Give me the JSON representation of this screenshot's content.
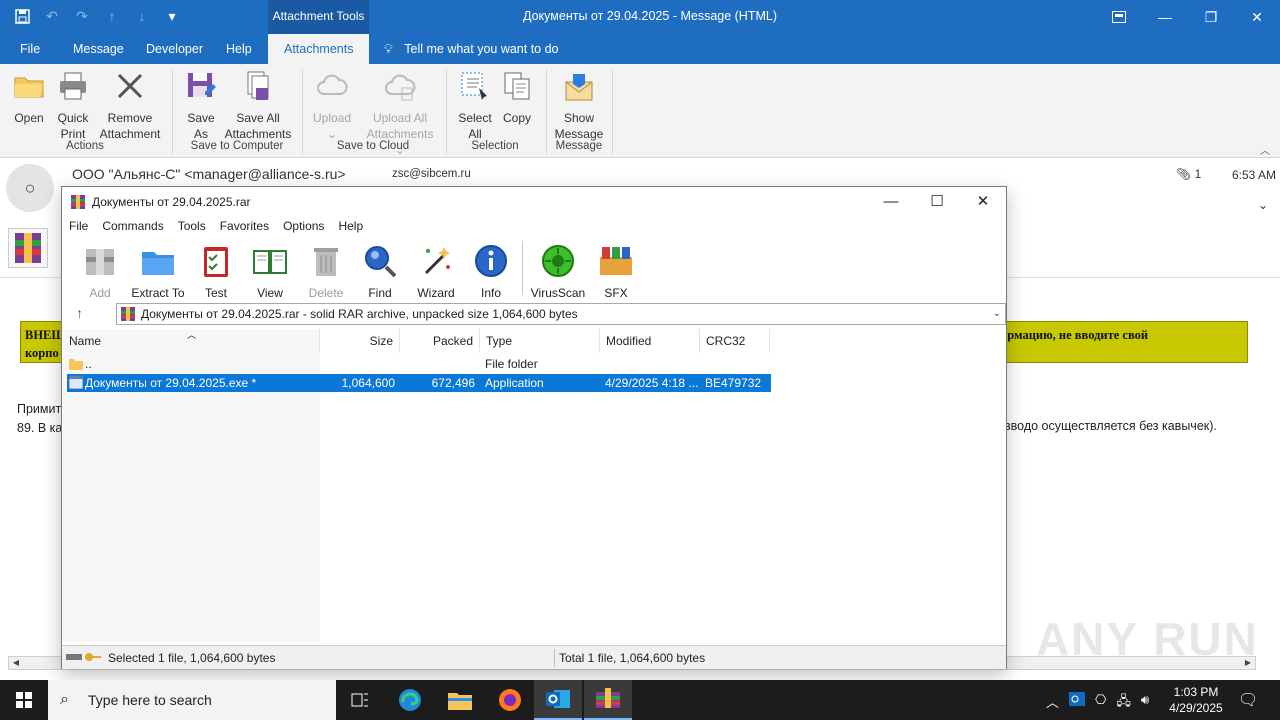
{
  "outlook": {
    "context_tab": "Attachment Tools",
    "window_title": "Документы от 29.04.2025  -  Message (HTML)",
    "tabs": [
      "File",
      "Message",
      "Developer",
      "Help",
      "Attachments"
    ],
    "active_tab": "Attachments",
    "tell_me": "Tell me what you want to do",
    "ribbon": {
      "open": "Open",
      "quick_print_1": "Quick",
      "quick_print_2": "Print",
      "remove_1": "Remove",
      "remove_2": "Attachment",
      "group_actions": "Actions",
      "save_as_1": "Save",
      "save_as_2": "As",
      "save_all_1": "Save All",
      "save_all_2": "Attachments",
      "group_save_computer": "Save to Computer",
      "upload": "Upload",
      "upload_all_1": "Upload All",
      "upload_all_2": "Attachments",
      "group_save_cloud": "Save to Cloud",
      "select_all_1": "Select",
      "select_all_2": "All",
      "copy": "Copy",
      "group_selection": "Selection",
      "show_message_1": "Show",
      "show_message_2": "Message",
      "group_message": "Message"
    },
    "header": {
      "from": "ООО \"Альянс-С\" <manager@alliance-s.ru>",
      "to": "zsc@sibcem.ru",
      "attachment_count": "1",
      "time": "6:53 AM"
    },
    "body": {
      "warning_left_1": "ВНЕШ",
      "warning_left_2": "корпо",
      "warning_right": "ормацию, не вводите свой",
      "line1": "Примит",
      "line2": "89. В ка",
      "line2_right": "вводо осуществляется без кавычек)."
    },
    "watermark": "ANY RUN"
  },
  "winrar": {
    "title": "Документы от 29.04.2025.rar",
    "menu": [
      "File",
      "Commands",
      "Tools",
      "Favorites",
      "Options",
      "Help"
    ],
    "tools": {
      "add": "Add",
      "extract": "Extract To",
      "test": "Test",
      "view": "View",
      "delete": "Delete",
      "find": "Find",
      "wizard": "Wizard",
      "info": "Info",
      "virusscan": "VirusScan",
      "sfx": "SFX"
    },
    "address": "Документы от 29.04.2025.rar - solid RAR archive, unpacked size 1,064,600 bytes",
    "columns": {
      "name": "Name",
      "size": "Size",
      "packed": "Packed",
      "type": "Type",
      "modified": "Modified",
      "crc": "CRC32"
    },
    "rows": [
      {
        "name": "..",
        "size": "",
        "packed": "",
        "type": "File folder",
        "modified": "",
        "crc": ""
      },
      {
        "name": "Документы от 29.04.2025.exe *",
        "size": "1,064,600",
        "packed": "672,496",
        "type": "Application",
        "modified": "4/29/2025 4:18 ...",
        "crc": "BE479732"
      }
    ],
    "status_left": "Selected 1 file, 1,064,600 bytes",
    "status_right": "Total 1 file, 1,064,600 bytes"
  },
  "taskbar": {
    "search_placeholder": "Type here to search",
    "time": "1:03 PM",
    "date": "4/29/2025"
  }
}
